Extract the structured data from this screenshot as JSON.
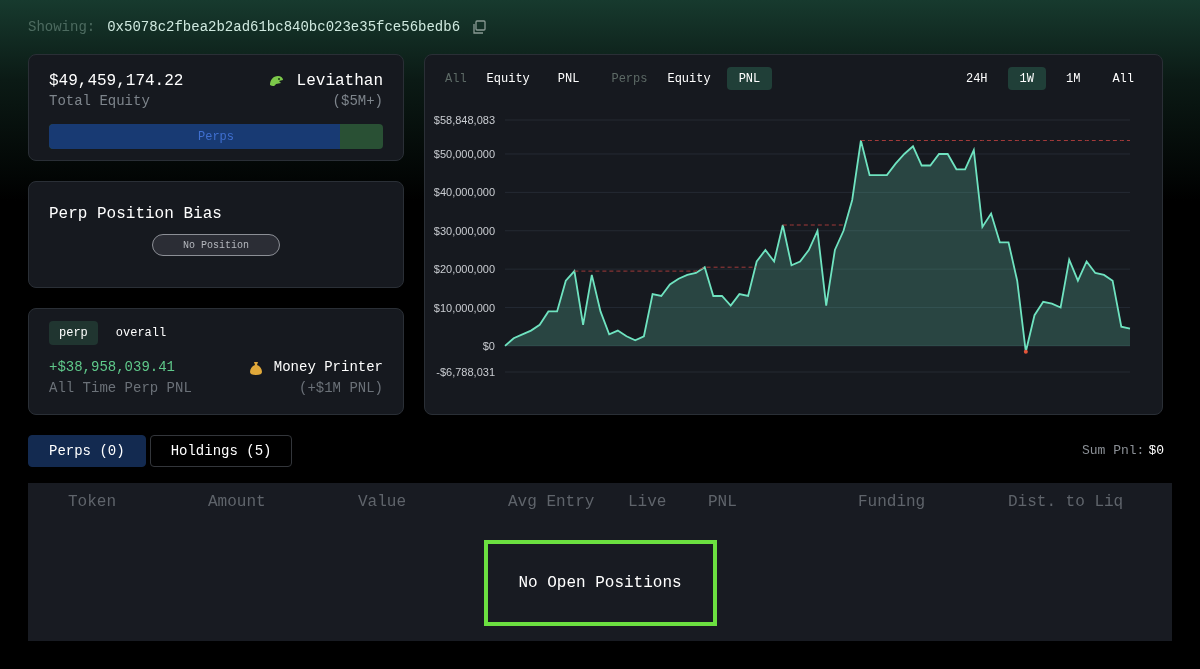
{
  "header": {
    "label": "Showing:",
    "address": "0x5078c2fbea2b2ad61bc840bc023e35fce56bedb6"
  },
  "equity_card": {
    "value": "$49,459,174.22",
    "caption": "Total Equity",
    "tier": "Leviathan",
    "tier_range": "($5M+)",
    "allocation": {
      "label": "Perps",
      "level": 0.87
    }
  },
  "bias_card": {
    "title": "Perp Position Bias",
    "status": "No Position"
  },
  "pnl_card": {
    "tabs": [
      {
        "label": "perp",
        "selected": true
      },
      {
        "label": "overall",
        "selected": false
      }
    ],
    "value": "+$38,958,039.41",
    "caption": "All Time Perp PNL",
    "tier": "Money Printer",
    "tier_range": "(+$1M PNL)"
  },
  "chart_panel": {
    "view_groups": [
      {
        "group": "All",
        "options": [
          {
            "label": "Equity",
            "selected": false
          },
          {
            "label": "PNL",
            "selected": false
          }
        ]
      },
      {
        "group": "Perps",
        "options": [
          {
            "label": "Equity",
            "selected": false
          },
          {
            "label": "PNL",
            "selected": true
          }
        ]
      }
    ],
    "ranges": [
      {
        "label": "24H",
        "selected": false
      },
      {
        "label": "1W",
        "selected": true
      },
      {
        "label": "1M",
        "selected": false
      },
      {
        "label": "All",
        "selected": false
      }
    ],
    "chart_data": {
      "type": "area",
      "grid": true,
      "ylim": [
        -6788031,
        58848083
      ],
      "yticks": [
        {
          "value": 58848083,
          "label": "$58,848,083"
        },
        {
          "value": 50000000,
          "label": "$50,000,000"
        },
        {
          "value": 40000000,
          "label": "$40,000,000"
        },
        {
          "value": 30000000,
          "label": "$30,000,000"
        },
        {
          "value": 20000000,
          "label": "$20,000,000"
        },
        {
          "value": 10000000,
          "label": "$10,000,000"
        },
        {
          "value": 0,
          "label": "$0"
        },
        {
          "value": -6788031,
          "label": "-$6,788,031"
        }
      ],
      "series": [
        {
          "color": "#6fe3c0",
          "values": [
            0,
            2000000,
            3000000,
            4000000,
            5500000,
            9000000,
            9000000,
            17000000,
            19500000,
            5500000,
            18500000,
            9000000,
            3000000,
            4000000,
            2500000,
            1500000,
            2500000,
            13500000,
            13000000,
            16000000,
            17500000,
            18500000,
            19000000,
            20500000,
            13000000,
            13000000,
            10500000,
            13500000,
            13000000,
            22000000,
            25000000,
            22000000,
            31500000,
            21000000,
            22000000,
            25000000,
            30000000,
            10500000,
            25000000,
            30000000,
            38000000,
            53500000,
            44500000,
            44500000,
            44500000,
            47500000,
            50000000,
            52000000,
            47000000,
            47000000,
            50000000,
            50000000,
            46000000,
            46000000,
            51000000,
            31000000,
            34500000,
            27000000,
            27000000,
            17000000,
            -1500000,
            8000000,
            11500000,
            11000000,
            10000000,
            22500000,
            17000000,
            22000000,
            19000000,
            18500000,
            17000000,
            5000000,
            4500000
          ]
        },
        {
          "type": "line",
          "line_style": "dashed",
          "color": "#a33a3a",
          "values": [
            null,
            null,
            null,
            null,
            null,
            null,
            null,
            null,
            19500000,
            19500000,
            19500000,
            19500000,
            19500000,
            19500000,
            19500000,
            19500000,
            19500000,
            19500000,
            19500000,
            19500000,
            19500000,
            19500000,
            19500000,
            20500000,
            20500000,
            20500000,
            20500000,
            20500000,
            20500000,
            20500000,
            null,
            null,
            31500000,
            31500000,
            31500000,
            31500000,
            31500000,
            31500000,
            31500000,
            31500000,
            null,
            53500000,
            53500000,
            53500000,
            53500000,
            53500000,
            53500000,
            53500000,
            53500000,
            53500000,
            53500000,
            53500000,
            53500000,
            53500000,
            53500000,
            53500000,
            53500000,
            53500000,
            53500000,
            53500000,
            53500000,
            53500000,
            53500000,
            53500000,
            53500000,
            53500000,
            53500000,
            53500000,
            53500000,
            53500000,
            53500000,
            53500000,
            53500000
          ]
        }
      ]
    }
  },
  "positions": {
    "tabs": [
      {
        "label": "Perps (0)",
        "selected": true
      },
      {
        "label": "Holdings (5)",
        "selected": false
      }
    ],
    "sum_label": "Sum Pnl:",
    "sum_value": "$0",
    "columns": [
      "Token",
      "Amount",
      "Value",
      "Avg Entry",
      "Live",
      "PNL",
      "Funding",
      "Dist. to Liq"
    ],
    "empty_message": "No Open Positions"
  }
}
